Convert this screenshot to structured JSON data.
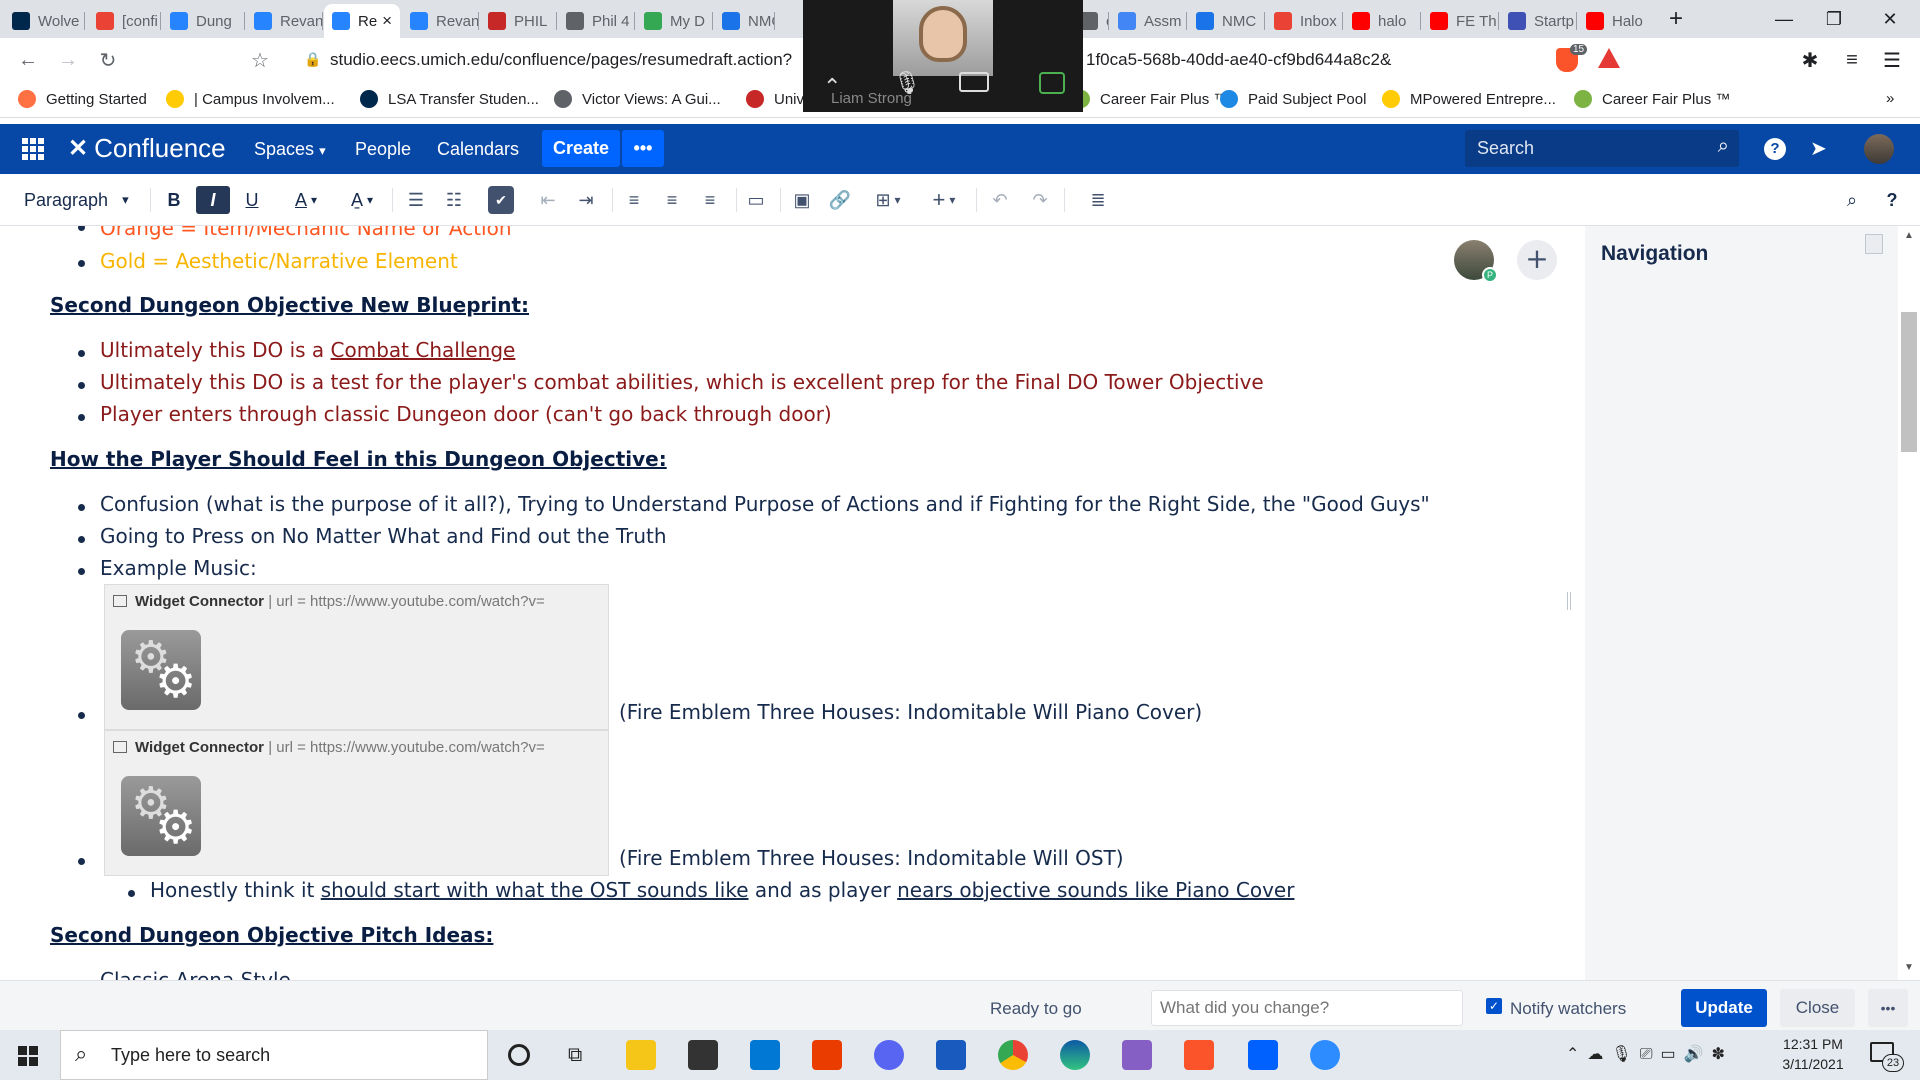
{
  "browser": {
    "tabs": [
      {
        "label": "Wolve",
        "color": "#00274c"
      },
      {
        "label": "[confi",
        "color": "#ea4335"
      },
      {
        "label": "Dung",
        "color": "#2684ff"
      },
      {
        "label": "Revan",
        "color": "#2684ff"
      },
      {
        "label": "Re",
        "color": "#2684ff",
        "active": true
      },
      {
        "label": "Revan",
        "color": "#2684ff"
      },
      {
        "label": "PHIL",
        "color": "#c62828"
      },
      {
        "label": "Phil 4",
        "color": "#5f6368"
      },
      {
        "label": "My D",
        "color": "#34a853"
      },
      {
        "label": "NMC",
        "color": "#1a73e8"
      },
      {
        "label": "ox",
        "color": "#5f6368"
      },
      {
        "label": "Assm",
        "color": "#4285f4"
      },
      {
        "label": "NMC",
        "color": "#1a73e8"
      },
      {
        "label": "Inbox",
        "color": "#ea4335"
      },
      {
        "label": "halo",
        "color": "#ff0000"
      },
      {
        "label": "FE Th",
        "color": "#ff0000"
      },
      {
        "label": "Startp",
        "color": "#3f51b5"
      },
      {
        "label": "Halo",
        "color": "#ff0000"
      }
    ],
    "tab_close": "×",
    "new_tab": "+",
    "url_left": "studio.eecs.umich.edu/confluence/pages/resumedraft.action?",
    "url_right": "1f0ca5-568b-40dd-ae40-cf9bd644a8c2&",
    "brave_badge": "15",
    "bookmarks": [
      {
        "label": "Getting Started",
        "color": "#ff7043"
      },
      {
        "label": "| Campus Involvem...",
        "color": "#ffcb05"
      },
      {
        "label": "LSA Transfer Studen...",
        "color": "#00274c"
      },
      {
        "label": "Victor Views: A Gui...",
        "color": "#5f6368"
      },
      {
        "label": "Univ",
        "color": "#c62828"
      },
      {
        "label": "Career Fair Plus ™",
        "color": "#7cb342"
      },
      {
        "label": "Paid Subject Pool",
        "color": "#1e88e5"
      },
      {
        "label": "MPowered Entrepre...",
        "color": "#ffcb05"
      },
      {
        "label": "Career Fair Plus ™",
        "color": "#7cb342"
      }
    ]
  },
  "zoom": {
    "participant": "Liam Strong"
  },
  "header": {
    "logo": "Confluence",
    "spaces": "Spaces",
    "people": "People",
    "calendars": "Calendars",
    "create": "Create",
    "more": "•••",
    "search_placeholder": "Search"
  },
  "toolbar": {
    "paragraph": "Paragraph"
  },
  "content": {
    "legend_orange": "Orange = Item/Mechanic Name or Action",
    "legend_gold": "Gold = Aesthetic/Narrative Element",
    "heading_blueprint": "Second Dungeon Objective New Blueprint:",
    "bp1_prefix": "Ultimately this DO is a ",
    "bp1_link": "Combat Challenge",
    "bp2": "Ultimately this DO is a test for the player's combat abilities, which is excellent prep for the Final DO Tower Objective",
    "bp3": "Player enters through classic Dungeon door (can't go back through door)",
    "heading_feel": "How the Player Should Feel in this Dungeon Objective:",
    "feel1": "Confusion (what is the purpose of it all?), Trying to Understand Purpose of Actions and if Fighting for the Right Side, the \"Good Guys\"",
    "feel2": "Going to Press on No Matter What and Find out the Truth",
    "feel3": "Example Music:",
    "widget_title": "Widget Connector",
    "widget_url": "| url = https://www.youtube.com/watch?v=",
    "music1": "(Fire Emblem Three Houses: Indomitable Will Piano Cover)",
    "music2": "(Fire Emblem Three Houses: Indomitable Will OST)",
    "sub1_a": "Honestly think it ",
    "sub1_b": "should start with what the OST sounds like",
    "sub1_c": " and as player ",
    "sub1_d": "nears objective sounds like Piano Cover",
    "heading_pitch": "Second Dungeon Objective Pitch Ideas:",
    "pitch1": "Classic Arena Style"
  },
  "nav": {
    "title": "Navigation"
  },
  "bottom": {
    "status": "Ready to go",
    "change_placeholder": "What did you change?",
    "notify": "Notify watchers",
    "update": "Update",
    "close": "Close",
    "more": "•••"
  },
  "taskbar": {
    "search_placeholder": "Type here to search",
    "time": "12:31 PM",
    "date": "3/11/2021",
    "notif_count": "23"
  }
}
